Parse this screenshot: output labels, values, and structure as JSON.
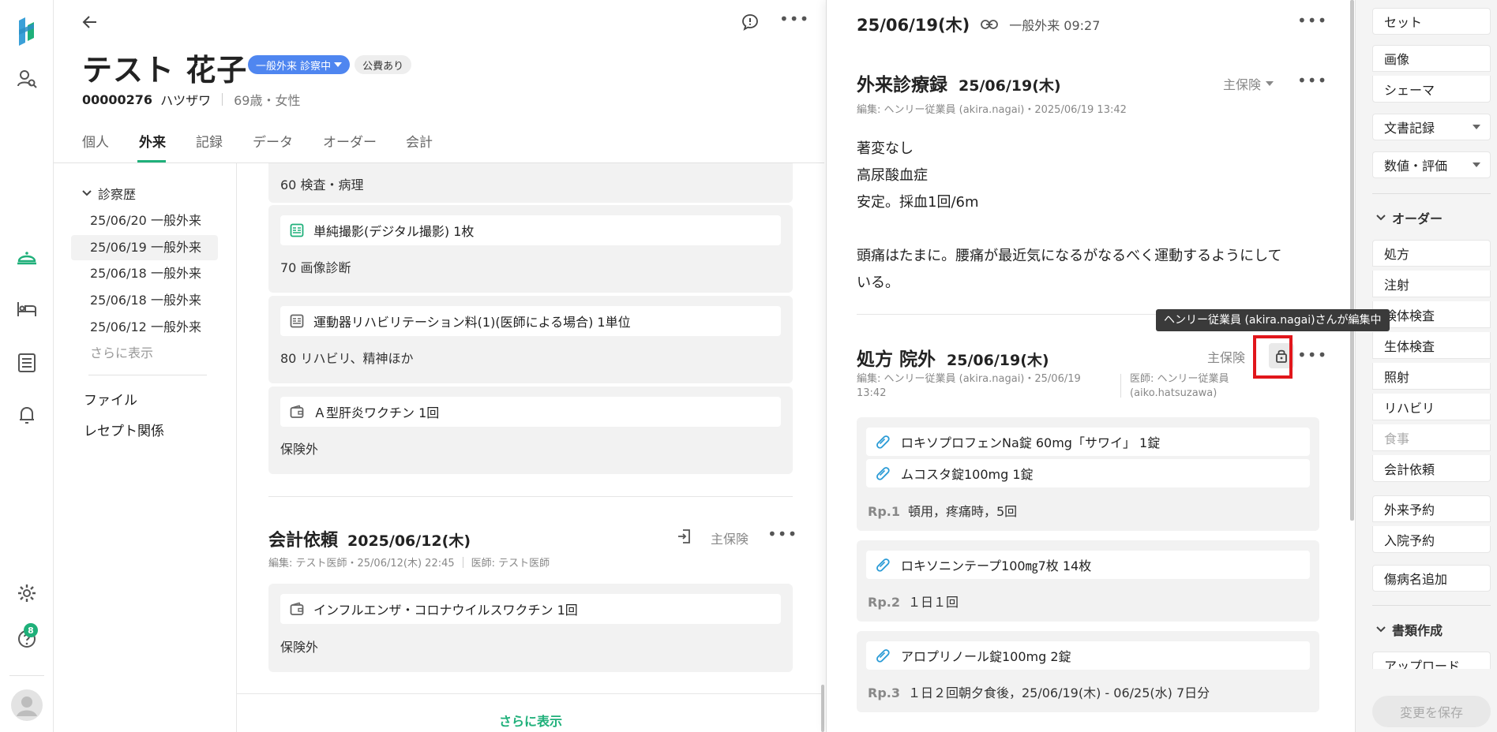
{
  "rail": {
    "badge_count": "8",
    "active_color": "#1fb07a"
  },
  "patient": {
    "name": "テスト 花子",
    "status": "一般外来 診察中",
    "public_expense": "公費あり",
    "id": "00000276",
    "kana": "ハツザワ",
    "age_sex": "69歳・女性"
  },
  "tabs": [
    {
      "label": "個人"
    },
    {
      "label": "外来"
    },
    {
      "label": "記録"
    },
    {
      "label": "データ"
    },
    {
      "label": "オーダー"
    },
    {
      "label": "会計"
    }
  ],
  "history": {
    "header": "診察歴",
    "items": [
      {
        "label": "25/06/20 一般外来"
      },
      {
        "label": "25/06/19 一般外来"
      },
      {
        "label": "25/06/18 一般外来"
      },
      {
        "label": "25/06/18 一般外来"
      },
      {
        "label": "25/06/12 一般外来"
      }
    ],
    "more": "さらに表示",
    "files": "ファイル",
    "receipt": "レセプト関係"
  },
  "middle": {
    "card0_sub": "60 検査・病理",
    "card1_item": "単純撮影(デジタル撮影)  1枚",
    "card1_sub": "70 画像診断",
    "card2_item": "運動器リハビリテーション料(1)(医師による場合)  1単位",
    "card2_sub": "80 リハビリ、精神ほか",
    "card3_item": "Ａ型肝炎ワクチン  1回",
    "card3_sub": "保険外",
    "billing_title": "会計依頼",
    "billing_date": "2025/06/12(木)",
    "billing_insurance": "主保険",
    "billing_meta_edit": "編集: テスト医師・25/06/12(木) 22:45",
    "billing_meta_doctor": "医師: テスト医師",
    "card4_item": "インフルエンザ・コロナウイルスワクチン  1回",
    "card4_sub": "保険外",
    "show_more": "さらに表示"
  },
  "record": {
    "header_date": "25/06/19(木)",
    "header_visit": "一般外来 09:27",
    "note_title": "外来診療録",
    "note_date": "25/06/19(木)",
    "note_insurance": "主保険",
    "note_meta": "編集: ヘンリー従業員 (akira.nagai)・2025/06/19 13:42",
    "note_lines": [
      "著変なし",
      "高尿酸血症",
      "安定。採血1回/6m",
      "",
      "頭痛はたまに。腰痛が最近気になるがなるべく運動するようにして",
      "いる。"
    ],
    "rx_title": "処方 院外",
    "rx_date": "25/06/19(木)",
    "rx_insurance": "主保険",
    "rx_meta_edit_1": "編集: ヘンリー従業員 (akira.nagai)・25/06/19",
    "rx_meta_edit_2": "13:42",
    "rx_meta_doctor_1": "医師: ヘンリー従業員",
    "rx_meta_doctor_2": "(aiko.hatsuzawa)",
    "tooltip": "ヘンリー従業員 (akira.nagai)さんが編集中",
    "rps": [
      {
        "label": "Rp.1",
        "drugs": [
          "ロキソプロフェンNa錠 60mg「サワイ」  1錠",
          "ムコスタ錠100mg  1錠"
        ],
        "usage": "頓用，疼痛時，5回"
      },
      {
        "label": "Rp.2",
        "drugs": [
          "ロキソニンテープ100㎎7枚  14枚"
        ],
        "usage": "１日１回"
      },
      {
        "label": "Rp.3",
        "drugs": [
          "アロプリノール錠100mg  2錠"
        ],
        "usage": "１日２回朝夕食後，25/06/19(木) - 06/25(水) 7日分"
      }
    ]
  },
  "tools": {
    "set": "セット",
    "image": "画像",
    "schema": "シェーマ",
    "document": "文書記録",
    "numeric": "数値・評価",
    "order_section": "オーダー",
    "orders": [
      "処方",
      "注射",
      "検体検査",
      "生体検査",
      "照射",
      "リハビリ",
      "食事",
      "会計依頼"
    ],
    "outpatient_booking": "外来予約",
    "admission_booking": "入院予約",
    "add_disease": "傷病名追加",
    "docs_section": "書類作成",
    "upload": "アップロード",
    "save": "変更を保存"
  }
}
